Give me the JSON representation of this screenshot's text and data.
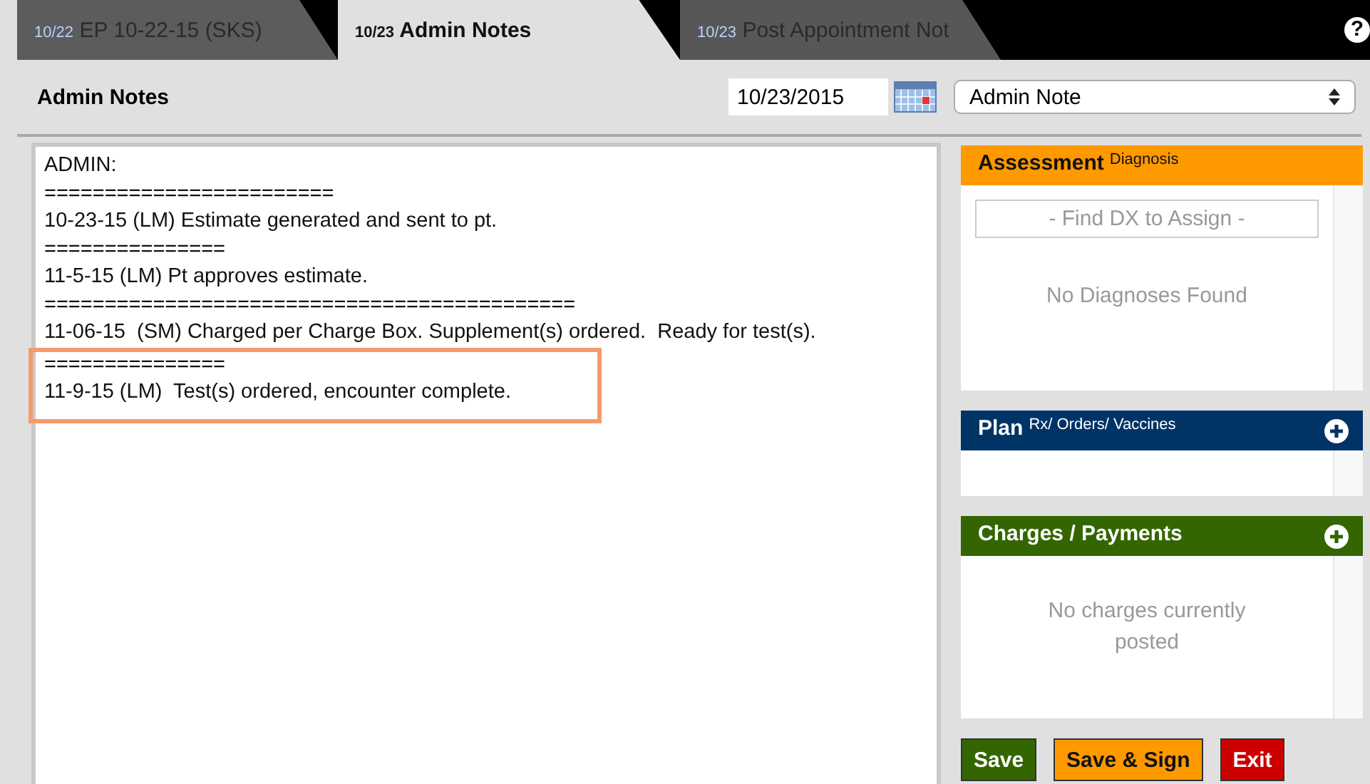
{
  "tabs": [
    {
      "date": "10/22",
      "label": "EP 10-22-15 (SKS)",
      "selected": false
    },
    {
      "date": "10/23",
      "label": "Admin Notes",
      "selected": true
    },
    {
      "date": "10/23",
      "label": "Post Appointment Not",
      "selected": false
    }
  ],
  "help": "?",
  "toolbar": {
    "title": "Admin Notes",
    "date": "10/23/2015",
    "note_type": "Admin Note"
  },
  "notes": [
    {
      "text": "ADMIN:",
      "highlighted": false
    },
    {
      "text": "========================",
      "highlighted": false
    },
    {
      "text": "10-23-15 (LM) Estimate generated and sent to pt.",
      "highlighted": false
    },
    {
      "text": "===============",
      "highlighted": false
    },
    {
      "text": "11-5-15 (LM) Pt approves estimate.",
      "highlighted": false
    },
    {
      "text": "============================================",
      "highlighted": false
    },
    {
      "text": "11-06-15  (SM) Charged per Charge Box. Supplement(s) ordered.  Ready for test(s).",
      "highlighted": false
    },
    {
      "text": "===============",
      "highlighted": true
    },
    {
      "text": "11-9-15 (LM)  Test(s) ordered, encounter complete.",
      "highlighted": true
    }
  ],
  "panels": [
    {
      "title": "Assessment",
      "subtitle": "Diagnosis",
      "color": "#ff9900",
      "add": false,
      "placeholder": "- Find DX to Assign -",
      "empty": "No Diagnoses Found"
    },
    {
      "title": "Plan",
      "subtitle": "Rx/ Orders/ Vaccines",
      "color": "#003366",
      "add": true
    },
    {
      "title": "Charges / Payments",
      "color": "#336600",
      "add": true,
      "empty": "No charges currently posted"
    }
  ],
  "buttons": [
    {
      "label": "Save",
      "color": "#336600"
    },
    {
      "label": "Save & Sign",
      "color": "#ff9900"
    },
    {
      "label": "Exit",
      "color": "#cc0000"
    }
  ]
}
